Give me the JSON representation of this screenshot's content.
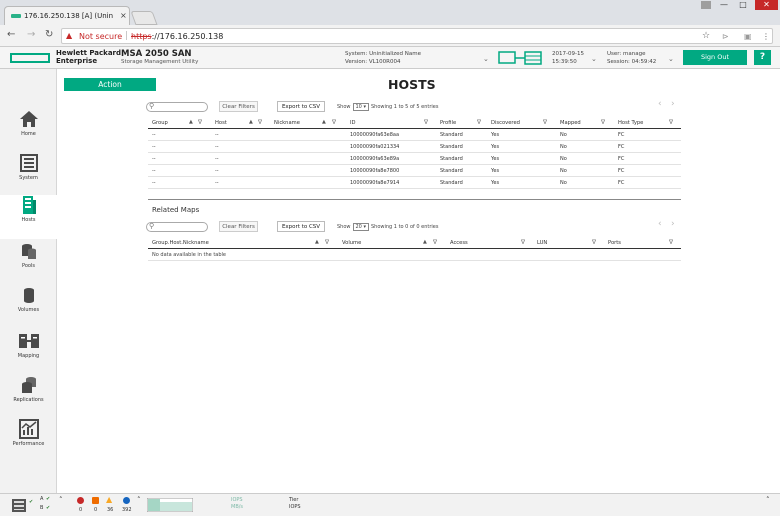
{
  "browser": {
    "tab_title": "176.16.250.138 [A] (Unin",
    "tab_close": "×",
    "security_label": "Not secure",
    "url_scheme": "https",
    "url_rest": "://176.16.250.138",
    "window_minimize": "—",
    "window_maximize": "□",
    "window_close": "✕"
  },
  "header": {
    "brand_line1": "Hewlett Packard",
    "brand_line2": "Enterprise",
    "product_name": "MSA 2050 SAN",
    "product_sub": "Storage Management Utility",
    "system_label": "System: Uninitialized Name",
    "version_label": "Version: VL100R004",
    "date": "2017-09-15",
    "time": "15:39:50",
    "user_label": "User: manage",
    "session_label": "Session: 04:59:42",
    "signout_label": "Sign Out",
    "help_label": "?"
  },
  "sidebar": {
    "items": [
      {
        "label": "Home",
        "icon": "home-icon"
      },
      {
        "label": "System",
        "icon": "system-icon"
      },
      {
        "label": "Hosts",
        "icon": "hosts-icon"
      },
      {
        "label": "Pools",
        "icon": "pools-icon"
      },
      {
        "label": "Volumes",
        "icon": "volumes-icon"
      },
      {
        "label": "Mapping",
        "icon": "mapping-icon"
      },
      {
        "label": "Replications",
        "icon": "replications-icon"
      },
      {
        "label": "Performance",
        "icon": "performance-icon"
      }
    ],
    "active": "Hosts"
  },
  "main": {
    "action_label": "Action",
    "page_title": "HOSTS",
    "clear_filters": "Clear Filters",
    "export_csv": "Export to CSV",
    "hosts_table": {
      "show_label": "Show",
      "show_value": "10",
      "showing_text": "Showing 1 to 5 of 5 entries",
      "columns": [
        "Group",
        "Host",
        "Nickname",
        "ID",
        "Profile",
        "Discovered",
        "Mapped",
        "Host Type"
      ],
      "rows": [
        [
          "--",
          "--",
          "",
          "10000090fa63e8aa",
          "Standard",
          "Yes",
          "No",
          "FC"
        ],
        [
          "--",
          "--",
          "",
          "10000090fa021334",
          "Standard",
          "Yes",
          "No",
          "FC"
        ],
        [
          "--",
          "--",
          "",
          "10000090fa63e89a",
          "Standard",
          "Yes",
          "No",
          "FC"
        ],
        [
          "--",
          "--",
          "",
          "10000090fa8e7800",
          "Standard",
          "Yes",
          "No",
          "FC"
        ],
        [
          "--",
          "--",
          "",
          "10000090fa8e7914",
          "Standard",
          "Yes",
          "No",
          "FC"
        ]
      ]
    },
    "related_maps": {
      "title": "Related Maps",
      "show_label": "Show",
      "show_value": "20",
      "showing_text": "Showing 1 to 0 of 0 entries",
      "columns": [
        "Group.Host.Nickname",
        "Volume",
        "Access",
        "LUN",
        "Ports"
      ],
      "empty_text": "No data available in the table"
    }
  },
  "statusbar": {
    "counts": [
      "0",
      "0",
      "36",
      "392"
    ],
    "chart_label_1": "IOPS",
    "chart_label_2": "MB/s",
    "tier_label": "Tier",
    "tier_sub": "IOPS",
    "status_letters": [
      "A",
      "B"
    ]
  },
  "colors": {
    "accent": "#01a982",
    "danger": "#c62828"
  }
}
